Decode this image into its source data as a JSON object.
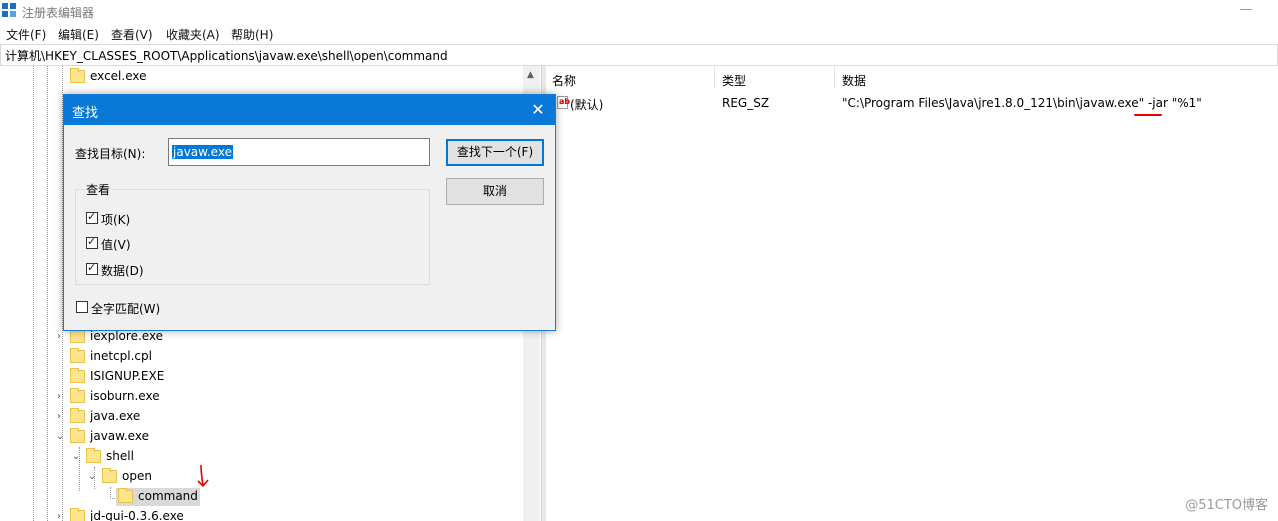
{
  "window": {
    "title": "注册表编辑器"
  },
  "menu": [
    "文件(F)",
    "编辑(E)",
    "查看(V)",
    "收藏夹(A)",
    "帮助(H)"
  ],
  "address": "计算机\\HKEY_CLASSES_ROOT\\Applications\\javaw.exe\\shell\\open\\command",
  "tree": {
    "items": [
      "excel.exe",
      "iexplore.exe",
      "inetcpl.cpl",
      "ISIGNUP.EXE",
      "isoburn.exe",
      "java.exe",
      "javaw.exe",
      "shell",
      "open",
      "command",
      "jd-gui-0.3.6.exe"
    ]
  },
  "list": {
    "headers": {
      "name": "名称",
      "type": "类型",
      "data": "数据"
    },
    "rows": [
      {
        "name": "(默认)",
        "type": "REG_SZ",
        "data": "\"C:\\Program Files\\Java\\jre1.8.0_121\\bin\\javaw.exe\" -jar \"%1\""
      }
    ]
  },
  "dialog": {
    "title": "查找",
    "find_label": "查找目标(N):",
    "find_value": "javaw.exe",
    "find_next": "查找下一个(F)",
    "cancel": "取消",
    "group_title": "查看",
    "opt_keys": "项(K)",
    "opt_values": "值(V)",
    "opt_data": "数据(D)",
    "whole_match": "全字匹配(W)",
    "checked": {
      "keys": true,
      "values": true,
      "data": true,
      "whole": false
    }
  },
  "watermark": "@51CTO博客",
  "colors": {
    "accent": "#0a78d7",
    "annotation": "#e00000"
  }
}
